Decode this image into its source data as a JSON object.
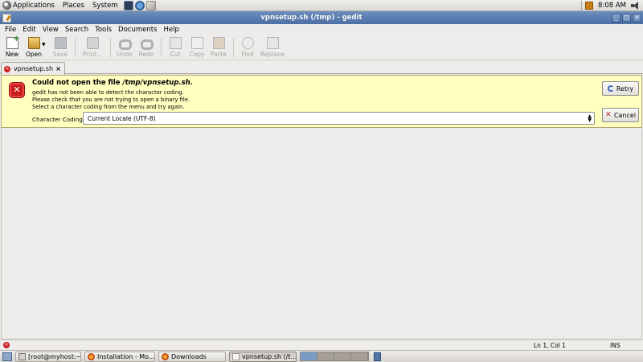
{
  "top_panel": {
    "menus": [
      "Applications",
      "Places",
      "System"
    ],
    "clock": "8:08 AM",
    "icons": [
      "gnome-foot-icon",
      "terminal-launcher-icon",
      "web-browser-launcher-icon",
      "mail-launcher-icon",
      "notes-icon",
      "volume-icon"
    ]
  },
  "window": {
    "title": "vpnsetup.sh (/tmp) - gedit",
    "controls": [
      "minimize",
      "maximize",
      "close"
    ]
  },
  "menubar": {
    "items": [
      {
        "label": "File"
      },
      {
        "label": "Edit"
      },
      {
        "label": "View"
      },
      {
        "label": "Search"
      },
      {
        "label": "Tools"
      },
      {
        "label": "Documents"
      },
      {
        "label": "Help"
      }
    ]
  },
  "toolbar": {
    "new_label": "New",
    "open_label": "Open",
    "save_label": "Save",
    "print_label": "Print...",
    "undo_label": "Undo",
    "redo_label": "Redo",
    "cut_label": "Cut",
    "copy_label": "Copy",
    "paste_label": "Paste",
    "find_label": "Find",
    "replace_label": "Replace"
  },
  "tab": {
    "label": "vpnsetup.sh",
    "close": "×"
  },
  "message": {
    "title_prefix": "Could not open the file ",
    "title_file": "/tmp/vpnsetup.sh.",
    "line1": "gedit has not been able to detect the character coding.",
    "line2": "Please check that you are not trying to open a binary file.",
    "line3": "Select a character coding from the menu and try again.",
    "coding_label": "Character Coding:",
    "coding_value": "Current Locale (UTF-8)",
    "retry_label": "Retry",
    "cancel_label": "Cancel"
  },
  "statusbar": {
    "position": "Ln 1, Col 1",
    "mode": "INS"
  },
  "bottom_panel": {
    "tasks": [
      {
        "label": "[root@myhost:~]",
        "active": false
      },
      {
        "label": "Installation - Mo...",
        "active": false
      },
      {
        "label": "Downloads",
        "active": false
      },
      {
        "label": "vpnsetup.sh (/t...",
        "active": true
      }
    ],
    "workspace_count": 4,
    "current_workspace": 1
  },
  "colors": {
    "titlebar": "#5a7fb3",
    "message_background": "#ffffbf",
    "error_red": "#c91d1d"
  }
}
